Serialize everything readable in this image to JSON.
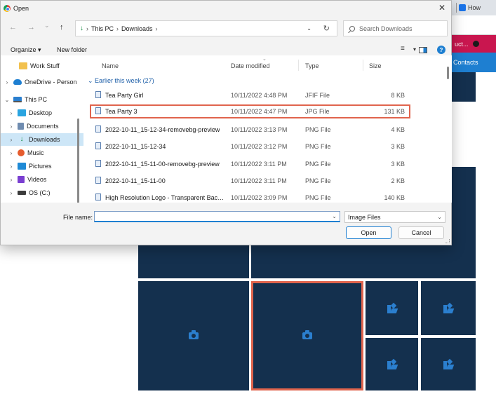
{
  "dialog": {
    "title": "Open",
    "close_glyph": "✕"
  },
  "address": {
    "back_glyph": "←",
    "forward_glyph": "→",
    "recent_glyph": "⌄",
    "up_glyph": "↑",
    "crumbs": [
      "This PC",
      "Downloads"
    ],
    "separator": "›",
    "refresh_glyph": "↻"
  },
  "search": {
    "placeholder": "Search Downloads"
  },
  "toolbar": {
    "organize_label": "Organize ▾",
    "new_folder_label": "New folder",
    "view_glyph": "≡",
    "help_glyph": "?"
  },
  "nav": {
    "items": [
      {
        "label": "Work Stuff",
        "icon": "folder-icon"
      },
      {
        "label": "OneDrive - Person",
        "icon": "cloud-icon"
      },
      {
        "label": "This PC",
        "icon": "pc-icon"
      },
      {
        "label": "Desktop",
        "icon": "desktop-icon"
      },
      {
        "label": "Documents",
        "icon": "documents-icon"
      },
      {
        "label": "Downloads",
        "icon": "download-icon"
      },
      {
        "label": "Music",
        "icon": "music-icon"
      },
      {
        "label": "Pictures",
        "icon": "pictures-icon"
      },
      {
        "label": "Videos",
        "icon": "videos-icon"
      },
      {
        "label": "OS (C:)",
        "icon": "drive-icon"
      }
    ]
  },
  "columns": {
    "name": "Name",
    "date": "Date modified",
    "type": "Type",
    "size": "Size"
  },
  "group_header": "Earlier this week (27)",
  "files": [
    {
      "name": "Tea Party Girl",
      "date": "10/11/2022 4:48 PM",
      "type": "JFIF File",
      "size": "8 KB"
    },
    {
      "name": "Tea Party 3",
      "date": "10/11/2022 4:47 PM",
      "type": "JPG File",
      "size": "131 KB"
    },
    {
      "name": "2022-10-11_15-12-34-removebg-preview",
      "date": "10/11/2022 3:13 PM",
      "type": "PNG File",
      "size": "4 KB"
    },
    {
      "name": "2022-10-11_15-12-34",
      "date": "10/11/2022 3:12 PM",
      "type": "PNG File",
      "size": "3 KB"
    },
    {
      "name": "2022-10-11_15-11-00-removebg-preview",
      "date": "10/11/2022 3:11 PM",
      "type": "PNG File",
      "size": "3 KB"
    },
    {
      "name": "2022-10-11_15-11-00",
      "date": "10/11/2022 3:11 PM",
      "type": "PNG File",
      "size": "2 KB"
    },
    {
      "name": "High Resolution Logo - Transparent Back...",
      "date": "10/11/2022 3:09 PM",
      "type": "PNG File",
      "size": "140 KB"
    }
  ],
  "footer": {
    "file_name_label": "File name:",
    "file_name_value": "",
    "file_type": "Image Files",
    "open_label": "Open",
    "cancel_label": "Cancel"
  },
  "browser": {
    "tab_label": "How",
    "pink_label": "uct...",
    "blue_label": "Contacts"
  },
  "colors": {
    "tile": "#14304e",
    "accent": "#1e7fd1",
    "highlight": "#e0644d"
  }
}
